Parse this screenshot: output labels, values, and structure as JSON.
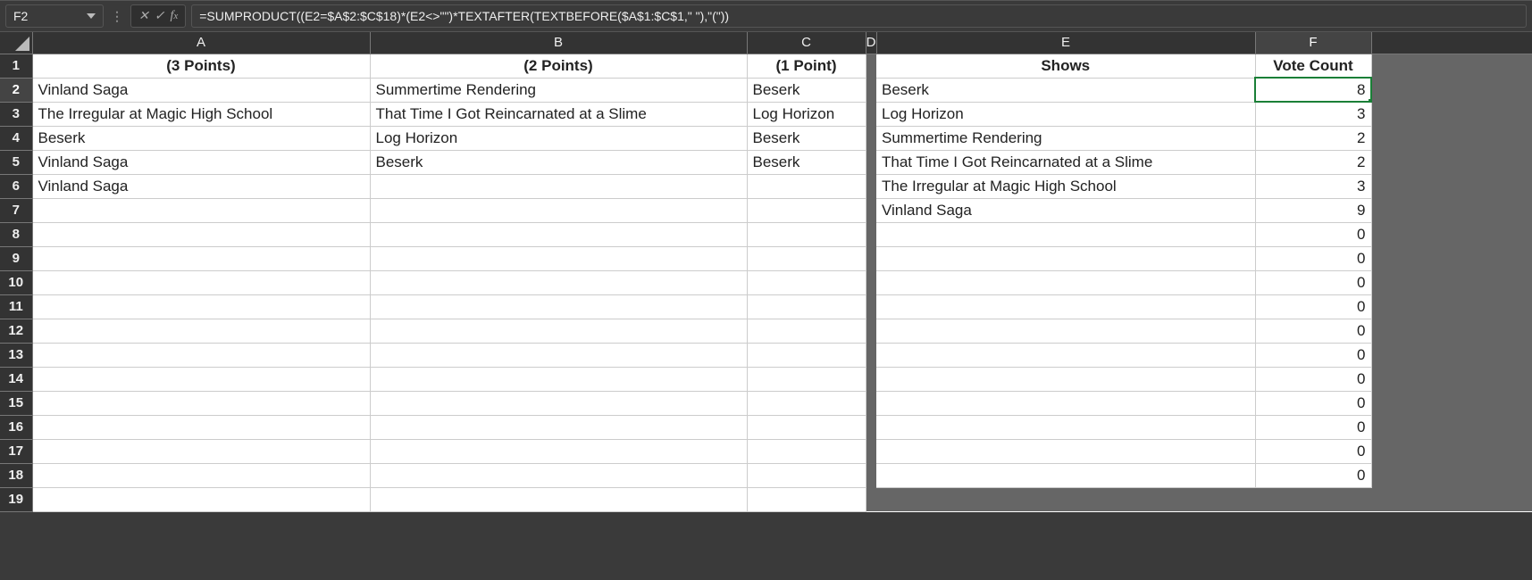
{
  "name_box": "F2",
  "formula": "=SUMPRODUCT((E2=$A$2:$C$18)*(E2<>\"\")*TEXTAFTER(TEXTBEFORE($A$1:$C$1,\" \"),\"(\"))",
  "col_heads": [
    "A",
    "B",
    "C",
    "D",
    "E",
    "F"
  ],
  "active_col": "F",
  "active_row": 2,
  "hdr": {
    "A": "(3 Points)",
    "B": "(2 Points)",
    "C": "(1 Point)",
    "E": "Shows",
    "F": "Vote Count"
  },
  "colA": [
    "Vinland Saga",
    "The Irregular at Magic High School",
    "Beserk",
    "Vinland Saga",
    "Vinland Saga",
    "",
    "",
    "",
    "",
    "",
    "",
    "",
    "",
    "",
    "",
    "",
    ""
  ],
  "colB": [
    "Summertime Rendering",
    "That Time I Got Reincarnated at a Slime",
    "Log Horizon",
    "Beserk",
    "",
    "",
    "",
    "",
    "",
    "",
    "",
    "",
    "",
    "",
    "",
    "",
    ""
  ],
  "colC": [
    "Beserk",
    "Log Horizon",
    "Beserk",
    "Beserk",
    "",
    "",
    "",
    "",
    "",
    "",
    "",
    "",
    "",
    "",
    "",
    "",
    ""
  ],
  "colE": [
    "Beserk",
    "Log Horizon",
    "Summertime Rendering",
    "That Time I Got Reincarnated at a Slime",
    "The Irregular at Magic High School",
    "Vinland Saga",
    "",
    "",
    "",
    "",
    "",
    "",
    "",
    "",
    "",
    "",
    ""
  ],
  "colF": [
    "8",
    "3",
    "2",
    "2",
    "3",
    "9",
    "0",
    "0",
    "0",
    "0",
    "0",
    "0",
    "0",
    "0",
    "0",
    "0",
    "0"
  ],
  "row_count": 19
}
